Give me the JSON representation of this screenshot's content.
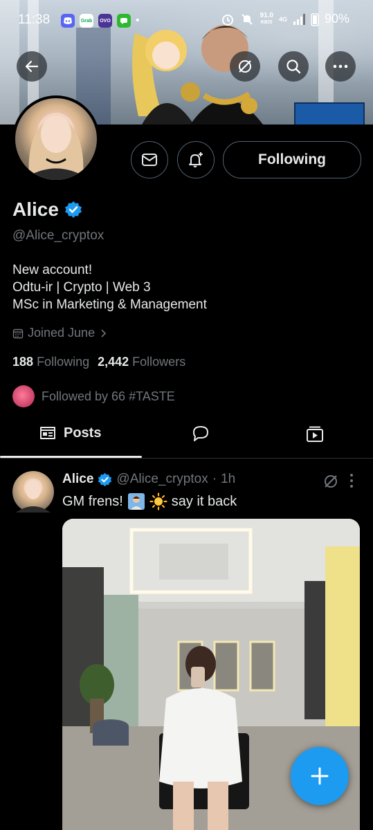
{
  "status_bar": {
    "time": "11:38",
    "apps": [
      "discord",
      "grab",
      "ovo",
      "messages"
    ],
    "net_speed": "91.0",
    "net_unit": "KB/S",
    "network": "4G",
    "battery": "90%"
  },
  "profile": {
    "name": "Alice",
    "handle": "@Alice_cryptox",
    "bio_lines": [
      "New account!",
      "Odtu-ir | Crypto | Web 3",
      "MSc in Marketing & Management"
    ],
    "joined": "Joined June",
    "following_count": "188",
    "following_label": "Following",
    "followers_count": "2,442",
    "followers_label": "Followers",
    "followed_by": "Followed by 66 #TASTE",
    "follow_button_label": "Following"
  },
  "tabs": {
    "posts_label": "Posts"
  },
  "post": {
    "name": "Alice",
    "handle": "@Alice_cryptox",
    "separator": "·",
    "time": "1h",
    "text_start": "GM frens!",
    "text_end": "say it back"
  },
  "colors": {
    "accent": "#1d9bf0",
    "background": "#000000",
    "text": "#e7e9ea",
    "muted": "#71767b"
  },
  "icons": [
    "back-arrow-icon",
    "grok-icon",
    "search-icon",
    "more-icon",
    "mail-icon",
    "bell-plus-icon",
    "verified-badge-icon",
    "calendar-icon",
    "chevron-right-icon",
    "posts-tab-icon",
    "reply-tab-icon",
    "media-tab-icon",
    "plus-icon"
  ]
}
